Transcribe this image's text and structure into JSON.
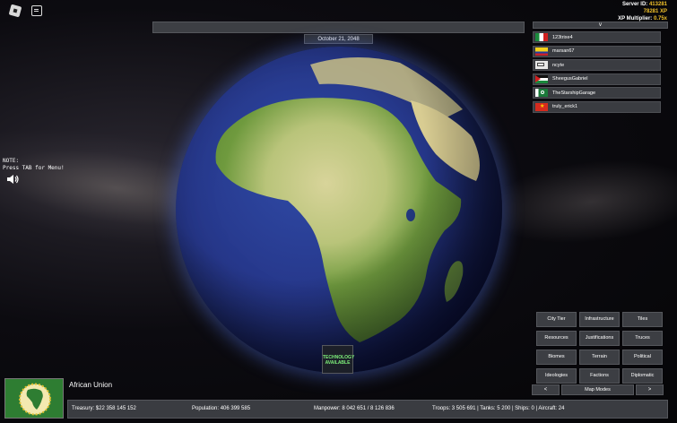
{
  "server": {
    "id_label": "Server ID:",
    "id_value": "413281",
    "xp_value": "78281 XP",
    "multiplier_label": "XP Multiplier:",
    "multiplier_value": "0.75x"
  },
  "date": "October 21, 2048",
  "player_list": {
    "collapse_label": "v",
    "players": [
      {
        "name": "123trixe4",
        "flag": "mexico"
      },
      {
        "name": "marsan67",
        "flag": "colombia"
      },
      {
        "name": "ncyte",
        "flag": "generic"
      },
      {
        "name": "SheegusGabriel",
        "flag": "sahrawi"
      },
      {
        "name": "TheStarshipGarage",
        "flag": "green-crescent"
      },
      {
        "name": "truly_erick1",
        "flag": "vietnam"
      }
    ]
  },
  "note": {
    "line1": "NOTE:",
    "line2": "Press TAB for Menu!"
  },
  "technology": {
    "line1": "TECHNOLOGY",
    "line2": "AVAILABLE"
  },
  "map_modes": {
    "buttons": [
      "City Tier",
      "Infrastructure",
      "Tiles",
      "Resources",
      "Justifications",
      "Truces",
      "Biomes",
      "Terrain",
      "Political",
      "Ideologies",
      "Factions",
      "Diplomatic"
    ],
    "prev_label": "<",
    "next_label": ">",
    "current_label": "Map Modes"
  },
  "nation": {
    "name": "African Union",
    "treasury": "Treasury:  $22 358 145 152",
    "population": "Population: 406 399 585",
    "manpower": "Manpower:  8 042 651  /  8 126 836",
    "military": "Troops: 3 505 691  |  Tanks: 5 200  |  Ships: 0  |  Aircraft: 24"
  },
  "colors": {
    "accent_gold": "#f0c02a",
    "tech_green": "#7ef07a",
    "panel": "#3a3c41"
  }
}
